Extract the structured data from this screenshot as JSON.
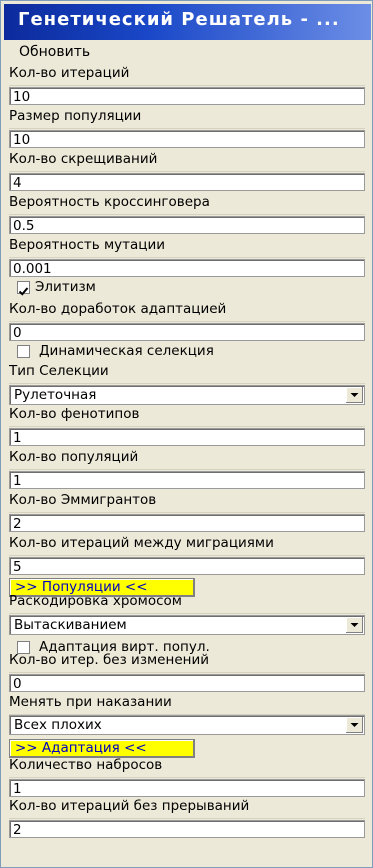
{
  "window": {
    "title": "Генетический Решатель - ..."
  },
  "toolbar": {
    "refresh_label": "Обновить"
  },
  "params": {
    "iterations": {
      "label": "Кол-во итераций",
      "value": "10"
    },
    "population_size": {
      "label": "Размер популяции",
      "value": "10"
    },
    "crossings": {
      "label": "Кол-во скрещиваний",
      "value": "4"
    },
    "crossover_prob": {
      "label": "Вероятность кроссинговера",
      "value": "0.5"
    },
    "mutation_prob": {
      "label": "Вероятность мутации",
      "value": "0.001"
    },
    "elitism": {
      "label": "Элитизм",
      "checked": true
    },
    "adapt_refinements": {
      "label": "Кол-во доработок адаптацией",
      "value": "0"
    },
    "dynamic_selection": {
      "label": "Динамическая селекция",
      "checked": false
    },
    "selection_type": {
      "label": "Тип Селекции",
      "value": "Рулеточная"
    },
    "phenotypes": {
      "label": "Кол-во фенотипов",
      "value": "1"
    },
    "populations": {
      "label": "Кол-во популяций",
      "value": "1"
    },
    "emigrants": {
      "label": "Кол-во Эммигрантов",
      "value": "2"
    },
    "iter_between_migrations": {
      "label": "Кол-во итераций между миграциями",
      "value": "5"
    },
    "populations_button": "&gt;&gt; Популяции &lt;&lt;",
    "chromosome_decoding": {
      "label": "Раскодировка хромосом",
      "value": "Вытаскиванием"
    },
    "adapt_virtual_pop": {
      "label": "Адаптация вирт. попул.",
      "checked": false
    },
    "iter_without_change": {
      "label": "Кол-во итер. без изменений",
      "value": "0"
    },
    "change_on_penalty": {
      "label": "Менять при наказании",
      "value": "Всех плохих"
    },
    "adaptation_button": "&gt;&gt; Адаптация &lt;&lt;",
    "throws_count": {
      "label": "Количество набросов",
      "value": "1"
    },
    "iter_without_interrupt": {
      "label": "Кол-во итераций без прерываний",
      "value": "2"
    }
  }
}
